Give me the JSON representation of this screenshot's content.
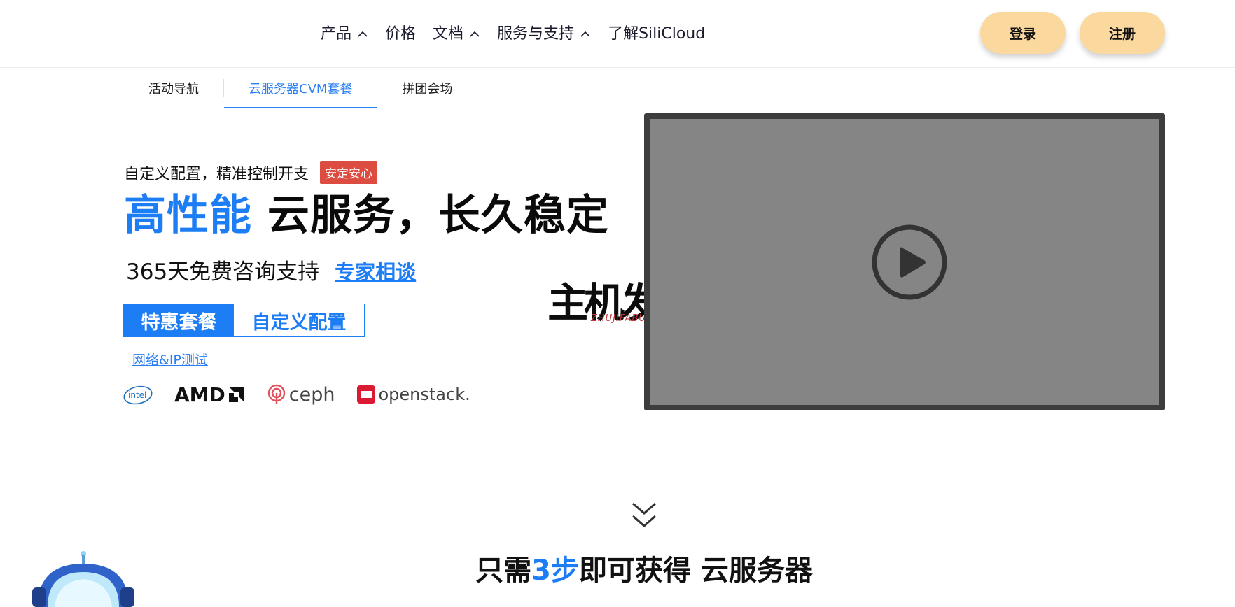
{
  "nav": {
    "items": [
      {
        "label": "产品",
        "has_dropdown": true
      },
      {
        "label": "价格",
        "has_dropdown": false
      },
      {
        "label": "文档",
        "has_dropdown": true
      },
      {
        "label": "服务与支持",
        "has_dropdown": true
      },
      {
        "label": "了解SiliCloud",
        "has_dropdown": false
      }
    ],
    "login_label": "登录",
    "register_label": "注册"
  },
  "subtabs": {
    "items": [
      {
        "label": "活动导航",
        "active": false
      },
      {
        "label": "云服务器CVM套餐",
        "active": true
      },
      {
        "label": "拼团会场",
        "active": false
      }
    ]
  },
  "hero": {
    "tagline": "自定义配置，精准控制开支",
    "badge": "安定安心",
    "headline_blue": "高性能",
    "headline_black": "云服务，长久稳定",
    "consult_text": "365天免费咨询支持",
    "expert_link": "专家相谈",
    "package_tabs": [
      {
        "label": "特惠套餐",
        "active": true
      },
      {
        "label": "自定义配置",
        "active": false
      }
    ],
    "network_link": "网络&IP测试",
    "partner_logos": [
      {
        "name": "intel",
        "text": "intel"
      },
      {
        "name": "amd",
        "text": "AMD"
      },
      {
        "name": "ceph",
        "text": "ceph"
      },
      {
        "name": "openstack",
        "text": "openstack."
      }
    ]
  },
  "watermark": {
    "cn": "主机发布",
    "en": "ZHUJIFABU"
  },
  "video": {
    "icon": "play-icon"
  },
  "steps": {
    "prefix": "只需",
    "number": "3步",
    "suffix": "即可获得 云服务器"
  },
  "colors": {
    "brand_blue": "#1d7df5",
    "button_peach": "#fbd89e",
    "badge_red": "#dc4c40",
    "video_gray": "#858585"
  }
}
